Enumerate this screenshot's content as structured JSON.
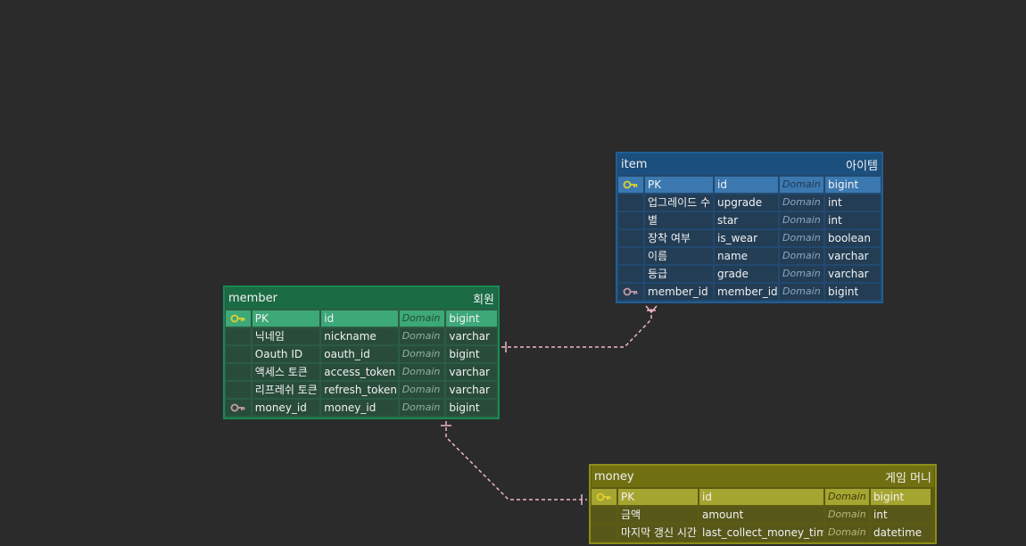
{
  "colors": {
    "canvas": "#2b2b2b",
    "member": "#1b6b45",
    "item": "#1b4f7d",
    "money": "#707013",
    "relationship_line": "#f0b6c8",
    "primary_key_icon": "#e0d030",
    "foreign_key_icon": "#c49aa8"
  },
  "tables": {
    "member": {
      "physical_name": "member",
      "logical_name": "회원",
      "columns": [
        {
          "key": "pk",
          "logical": "PK",
          "physical": "id",
          "domain": "Domain",
          "type": "bigint"
        },
        {
          "key": "",
          "logical": "닉네임",
          "physical": "nickname",
          "domain": "Domain",
          "type": "varchar"
        },
        {
          "key": "",
          "logical": "Oauth ID",
          "physical": "oauth_id",
          "domain": "Domain",
          "type": "bigint"
        },
        {
          "key": "",
          "logical": "액세스 토큰",
          "physical": "access_token",
          "domain": "Domain",
          "type": "varchar"
        },
        {
          "key": "",
          "logical": "리프레쉬 토큰",
          "physical": "refresh_token",
          "domain": "Domain",
          "type": "varchar"
        },
        {
          "key": "fk",
          "logical": "money_id",
          "physical": "money_id",
          "domain": "Domain",
          "type": "bigint"
        }
      ]
    },
    "item": {
      "physical_name": "item",
      "logical_name": "아이템",
      "columns": [
        {
          "key": "pk",
          "logical": "PK",
          "physical": "id",
          "domain": "Domain",
          "type": "bigint"
        },
        {
          "key": "",
          "logical": "업그레이드 수",
          "physical": "upgrade",
          "domain": "Domain",
          "type": "int"
        },
        {
          "key": "",
          "logical": "별",
          "physical": "star",
          "domain": "Domain",
          "type": "int"
        },
        {
          "key": "",
          "logical": "장착 여부",
          "physical": "is_wear",
          "domain": "Domain",
          "type": "boolean"
        },
        {
          "key": "",
          "logical": "이름",
          "physical": "name",
          "domain": "Domain",
          "type": "varchar"
        },
        {
          "key": "",
          "logical": "등급",
          "physical": "grade",
          "domain": "Domain",
          "type": "varchar"
        },
        {
          "key": "fk",
          "logical": "member_id",
          "physical": "member_id",
          "domain": "Domain",
          "type": "bigint"
        }
      ]
    },
    "money": {
      "physical_name": "money",
      "logical_name": "게임 머니",
      "columns": [
        {
          "key": "pk",
          "logical": "PK",
          "physical": "id",
          "domain": "Domain",
          "type": "bigint"
        },
        {
          "key": "",
          "logical": "금액",
          "physical": "amount",
          "domain": "Domain",
          "type": "int"
        },
        {
          "key": "",
          "logical": "마지막 갱신 시간",
          "physical": "last_collect_money_time",
          "domain": "Domain",
          "type": "datetime"
        }
      ]
    }
  },
  "relationships": [
    {
      "from": "member",
      "to": "item",
      "from_end": "one",
      "to_end": "many"
    },
    {
      "from": "member",
      "to": "money",
      "from_end": "one",
      "to_end": "one"
    }
  ]
}
